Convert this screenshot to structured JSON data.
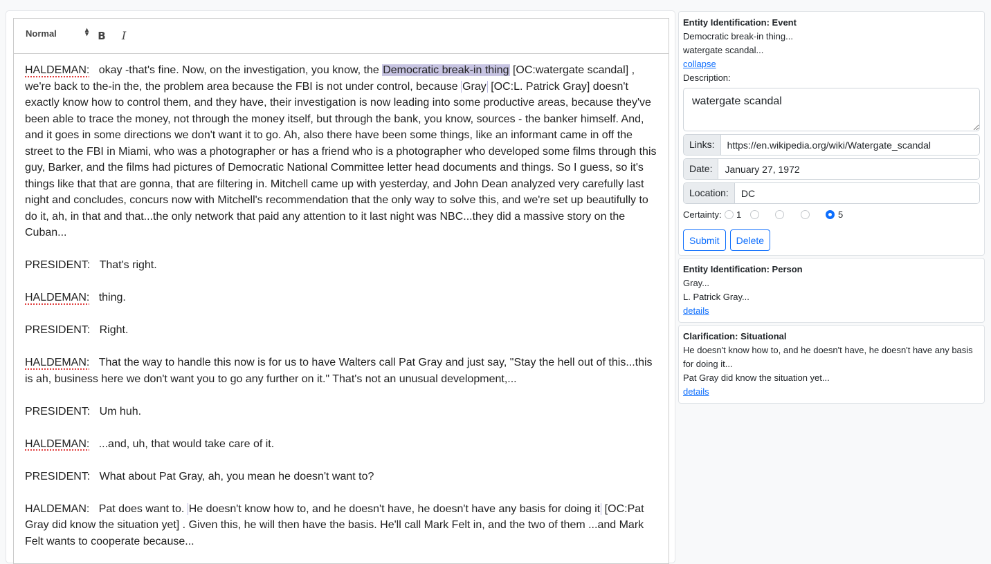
{
  "editor": {
    "toolbar": {
      "format_select": "Normal",
      "bold_label": "B",
      "italic_label": "I"
    },
    "paragraphs": [
      {
        "speaker": "HALDEMAN:",
        "speaker_spellcheck": true,
        "segments": {
          "s0": "okay -that's fine. Now, on the investigation, you know, the ",
          "highlight1": "Democratic break-in thing",
          "s1": " [OC:watergate scandal] , we're back to the-in the, the problem area because the FBI is not under control, because ",
          "anchor2": "Gray",
          "s2": " [OC:L. Patrick Gray]  doesn't exactly know how to control them, and they have, their investigation is now leading into some productive areas, because they've been able to trace the money, not through the money itself, but through the bank, you know, sources - the banker himself. And, and it goes in some directions we don't want it to go. Ah, also there have been some things, like an informant came in off the street to the FBI in Miami, who was a photographer or has a friend who is a photographer who developed some films through this guy, Barker, and the films had pictures of Democratic National Committee letter head documents and things. So I guess, so it's things like that that are gonna, that are filtering in. Mitchell came up with yesterday, and John Dean analyzed very carefully last night and concludes, concurs now with Mitchell's recommendation that the only way to solve this, and we're set up beautifully to do it, ah, in that and that...the only network that paid any attention to it last night was NBC...they did a massive story on the Cuban..."
        }
      },
      {
        "speaker": "PRESIDENT:",
        "text": "That's right."
      },
      {
        "speaker": "HALDEMAN:",
        "text": "thing."
      },
      {
        "speaker": "PRESIDENT:",
        "text": "Right."
      },
      {
        "speaker": "HALDEMAN:",
        "text": "That the way to handle this now is for us to have Walters call Pat Gray and just say, \"Stay the hell out of this...this is ah, business here we don't want you to go any further on it.\" That's not an unusual development,..."
      },
      {
        "speaker": "PRESIDENT:",
        "text": "Um huh."
      },
      {
        "speaker": "HALDEMAN:",
        "text": "...and, uh, that would take care of it."
      },
      {
        "speaker": "PRESIDENT:",
        "text": "What about Pat Gray, ah, you mean he doesn't want to?"
      },
      {
        "speaker": "HALDEMAN:",
        "segments": {
          "s0": "Pat does want to. ",
          "anchor3": "He doesn't know how to, and he doesn't have, he doesn't have any basis for doing it",
          "s1": " [OC:Pat Gray did know the situation yet] . Given this, he will then have the basis. He'll call Mark Felt in, and the two of them ...and Mark Felt wants to cooperate because..."
        }
      }
    ]
  },
  "annotations": [
    {
      "title": "Entity Identification: Event",
      "lines": [
        "Democratic break-in thing...",
        "watergate scandal..."
      ],
      "toggle_label": "collapse",
      "expanded": true,
      "description_label": "Description:",
      "description_value": "watergate scandal",
      "links_label": "Links:",
      "links_value": "https://en.wikipedia.org/wiki/Watergate_scandal",
      "date_label": "Date:",
      "date_value": "January 27, 1972",
      "location_label": "Location:",
      "location_value": "DC",
      "certainty_label": "Certainty:",
      "certainty_options": [
        "1",
        "",
        "",
        "",
        "5"
      ],
      "certainty_selected": 5,
      "submit_label": "Submit",
      "delete_label": "Delete"
    },
    {
      "title": "Entity Identification: Person",
      "lines": [
        "Gray...",
        "L. Patrick Gray..."
      ],
      "toggle_label": "details"
    },
    {
      "title": "Clarification: Situational",
      "lines": [
        "He doesn't know how to, and he doesn't have, he doesn't have any basis for doing it...",
        "Pat Gray did know the situation yet..."
      ],
      "toggle_label": "details"
    }
  ],
  "colors": {
    "highlight": "#c7c4e2",
    "link": "#0d6efd",
    "spellcheck": "#e03c3c"
  }
}
